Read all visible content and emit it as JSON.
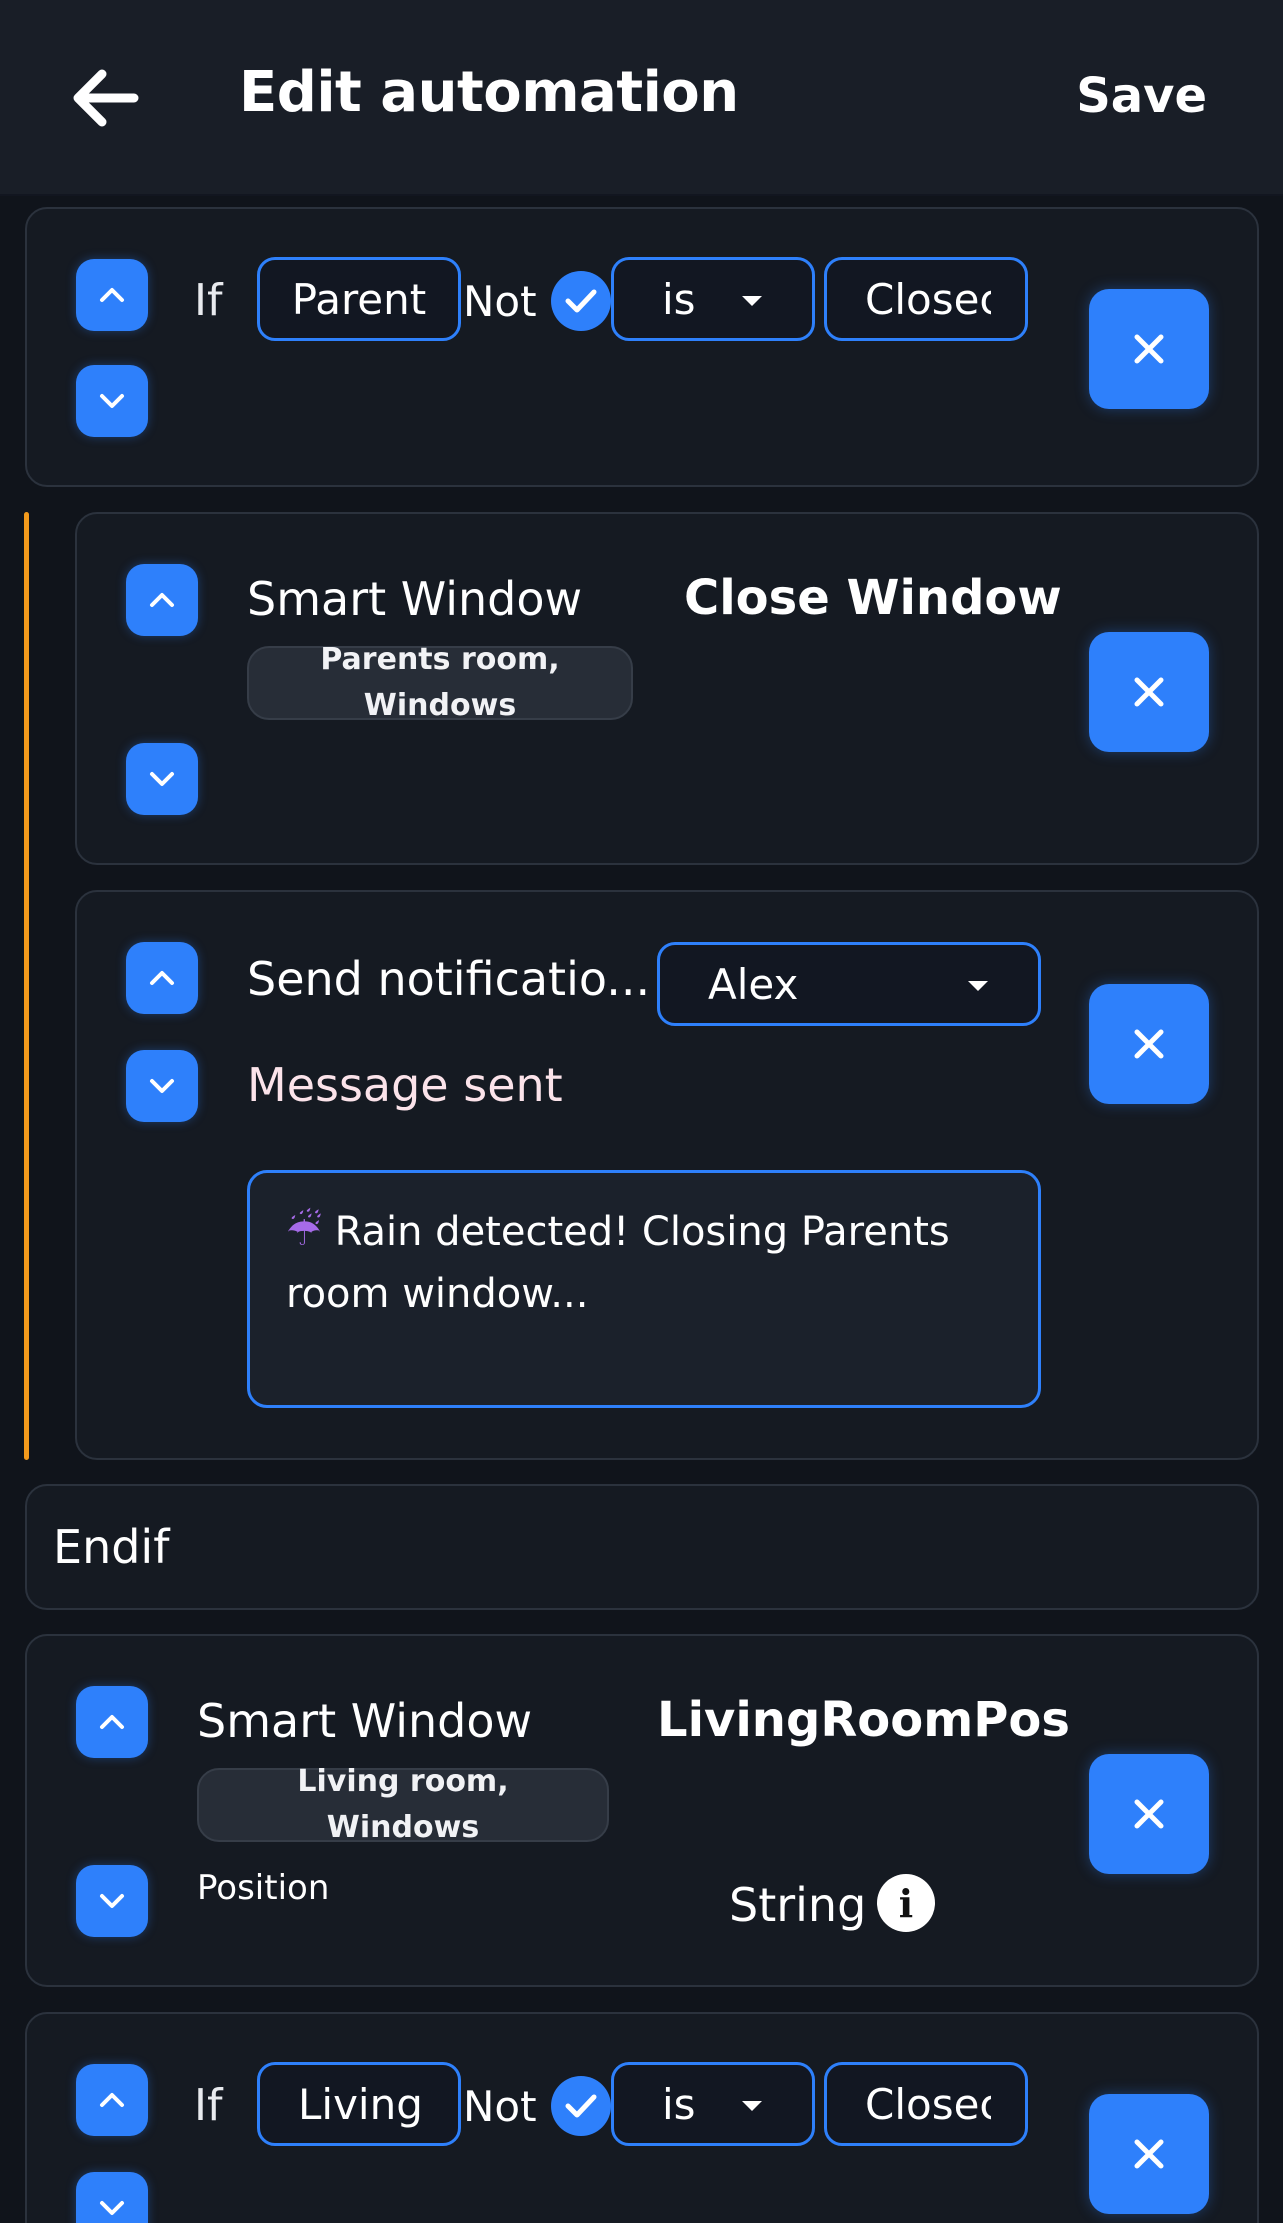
{
  "header": {
    "title": "Edit automation",
    "save_label": "Save",
    "back_icon": "arrow-left-icon"
  },
  "blocks": [
    {
      "type": "if",
      "keyword": "If",
      "subject": "Parent",
      "not_label": "Not",
      "not_checked": true,
      "operator": "is",
      "value": "Closec"
    },
    {
      "type": "action",
      "device": "Smart Window",
      "location_tag": "Parents room, Windows",
      "action_label": "Close Window"
    },
    {
      "type": "notification",
      "label": "Send notificatio...",
      "recipient": "Alex",
      "message_label": "Message sent",
      "message_emoji": "☔",
      "message_text": "Rain detected! Closing Parents room window..."
    },
    {
      "type": "endif",
      "label": "Endif"
    },
    {
      "type": "variable",
      "device": "Smart Window",
      "location_tag": "Living room, Windows",
      "variable_name": "LivingRoomPos",
      "property": "Position",
      "data_type": "String"
    },
    {
      "type": "if",
      "keyword": "If",
      "subject": "LivingI",
      "not_label": "Not",
      "not_checked": true,
      "operator": "is",
      "value": "Closec"
    }
  ],
  "colors": {
    "accent": "#2e80fb",
    "nesting_line": "#f39a1c",
    "background": "#10141b",
    "card": "#151a22"
  }
}
